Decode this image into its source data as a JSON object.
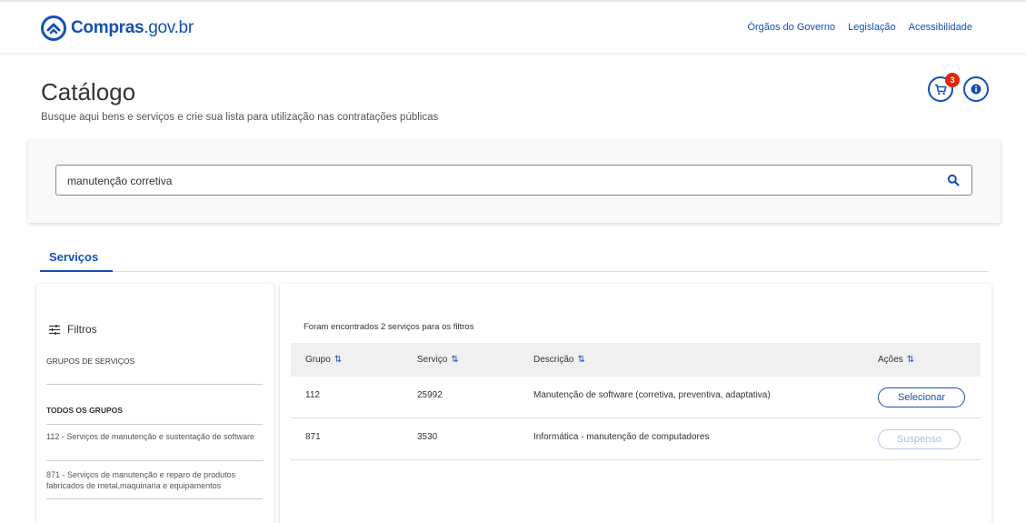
{
  "header": {
    "logo_text": "Compras",
    "logo_suffix": ".gov.br",
    "nav": [
      {
        "label": "Órgãos do Governo"
      },
      {
        "label": "Legislação"
      },
      {
        "label": "Acessibilidade"
      }
    ]
  },
  "page": {
    "title": "Catálogo",
    "subtitle": "Busque aqui bens e serviços e crie sua lista para utilização nas contratações públicas",
    "cart_count": "3",
    "cart_icon": "cart-icon",
    "info_icon": "info-icon"
  },
  "search": {
    "value": "manutenção corretiva",
    "icon": "search-icon"
  },
  "tabs": [
    {
      "label": "Serviços",
      "active": true
    }
  ],
  "filters": {
    "title": "Filtros",
    "icon": "sliders-icon",
    "group_heading": "GRUPOS DE SERVIÇOS",
    "all_groups": "TODOS OS GRUPOS",
    "groups": [
      {
        "label": "112 - Serviços de manutenção e sustentação de software"
      },
      {
        "label": "871 - Serviços de manutenção e reparo de produtos fabricados de metal,maquinaria e equipamentos"
      }
    ]
  },
  "results": {
    "summary": "Foram encontrados 2 serviços para os filtros",
    "sort_icon": "⇅",
    "columns": [
      "Grupo",
      "Serviço",
      "Descrição",
      "Ações"
    ],
    "rows": [
      {
        "grupo": "112",
        "servico": "25992",
        "descricao": "Manutenção de software (corretiva, preventiva, adaptativa)",
        "acao": "Selecionar"
      },
      {
        "grupo": "871",
        "servico": "3530",
        "descricao": "Informática - manutenção de computadores",
        "acao": "Suspenso"
      }
    ]
  },
  "colors": {
    "primary": "#1351b4",
    "badge": "#e52207",
    "disabled": "#aabfe0"
  }
}
